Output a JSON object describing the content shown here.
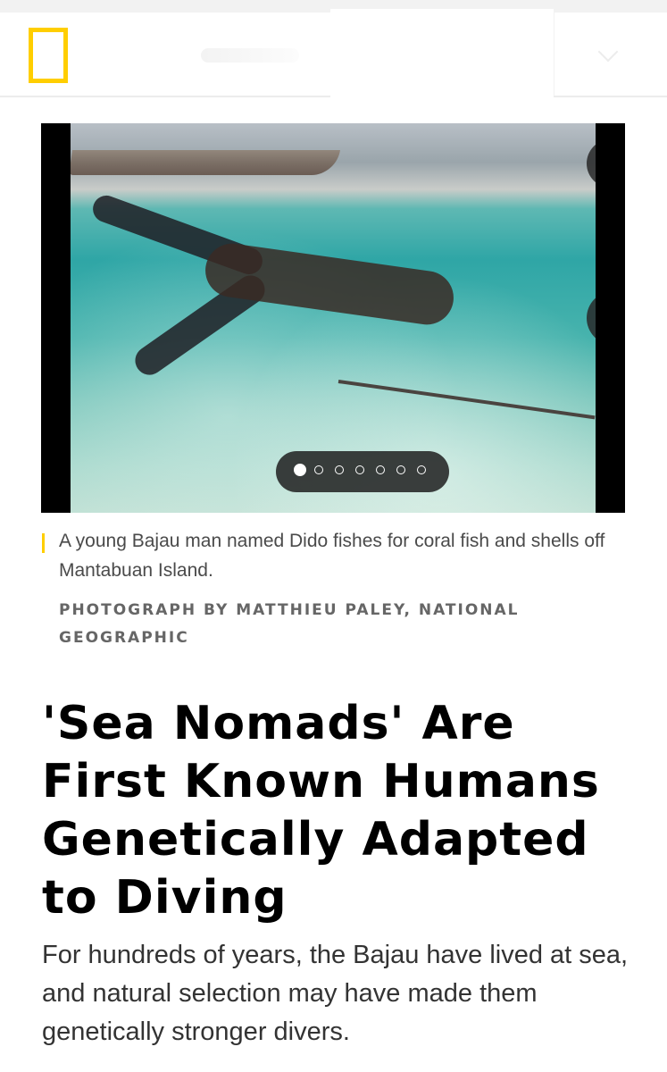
{
  "header": {
    "logo_icon": "national-geographic-yellow-border-logo",
    "menu_icon": "chevron-down-icon",
    "brand_color": "#ffce00"
  },
  "gallery": {
    "image_subject": "A young Bajau man named Dido fishes for coral fish and shells off Mantabuan Island.",
    "fullscreen_icon": "fullscreen-icon",
    "next_icon": "chevron-right-icon",
    "slide_count": 7,
    "active_slide": 1
  },
  "caption": {
    "text": "A young Bajau man named Dido fishes for coral fish and shells off Mantabuan Island.",
    "credit": "PHOTOGRAPH BY MATTHIEU PALEY, NATIONAL GEOGRAPHIC"
  },
  "article": {
    "headline": "'Sea Nomads' Are First Known Humans Genetically Adapted to Diving",
    "dek": "For hundreds of years, the Bajau have lived at sea, and natural selection may have made them genetically stronger divers."
  }
}
